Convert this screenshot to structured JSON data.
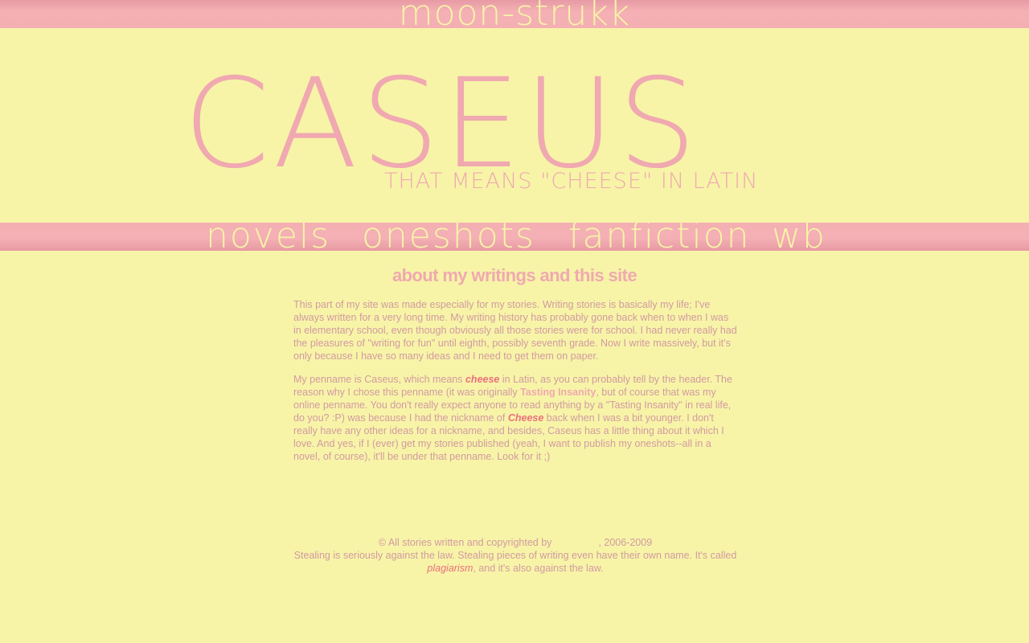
{
  "site": {
    "name": "moon-strukk"
  },
  "header": {
    "title": "CASEUS",
    "subtitle": "THAT MEANS \"CHEESE\" IN LATIN"
  },
  "nav": {
    "items": [
      {
        "label": "novels"
      },
      {
        "label": "oneshots"
      },
      {
        "label": "fanfiction"
      },
      {
        "label": "wb"
      }
    ]
  },
  "main": {
    "heading": "about my writings and this site",
    "para1": "This part of my site was made especially for my stories. Writing stories is basically my life; I've always written for a very long time. My writing history has probably gone back when to when I was in elementary school, even though obviously all those stories were for school. I had never really had the pleasures of \"writing for fun\" until eighth, possibly seventh grade. Now I write massively, but it's only because I have so many ideas and I need to get them on paper.",
    "para2": {
      "t1": "My penname is Caseus, which means ",
      "em1": "cheese",
      "t2": " in Latin, as you can probably tell by the header. The reason why I chose this penname (it was originally ",
      "link1": "Tasting Insanity",
      "t3": ", but of course that was my online penname. You don't really expect anyone to read anything by a \"Tasting Insanity\" in real life, do you? :P) was because I had the nickname of ",
      "em2": "Cheese",
      "t4": " back when I was a bit younger. I don't really have any other ideas for a nickname, and besides, Caseus has a little thing about it which I love. And yes, if I (ever) get my stories published (yeah, I want to publish my oneshots--all in a novel, of course), it'll be under that penname. Look for it ;)"
    }
  },
  "footer": {
    "copyright_prefix": "© All stories written and copyrighted by",
    "copyright_suffix": ", 2006-2009",
    "line2_a": "Stealing is seriously against the law. Stealing pieces of writing even have their own name. It's called ",
    "plagiarism": "plagiarism",
    "line2_b": ", and it's also against the law."
  },
  "colors": {
    "background": "#f7f4a8",
    "pink": "#f0a9b0",
    "text": "#d39aa1",
    "accent": "#ec6f7e"
  }
}
